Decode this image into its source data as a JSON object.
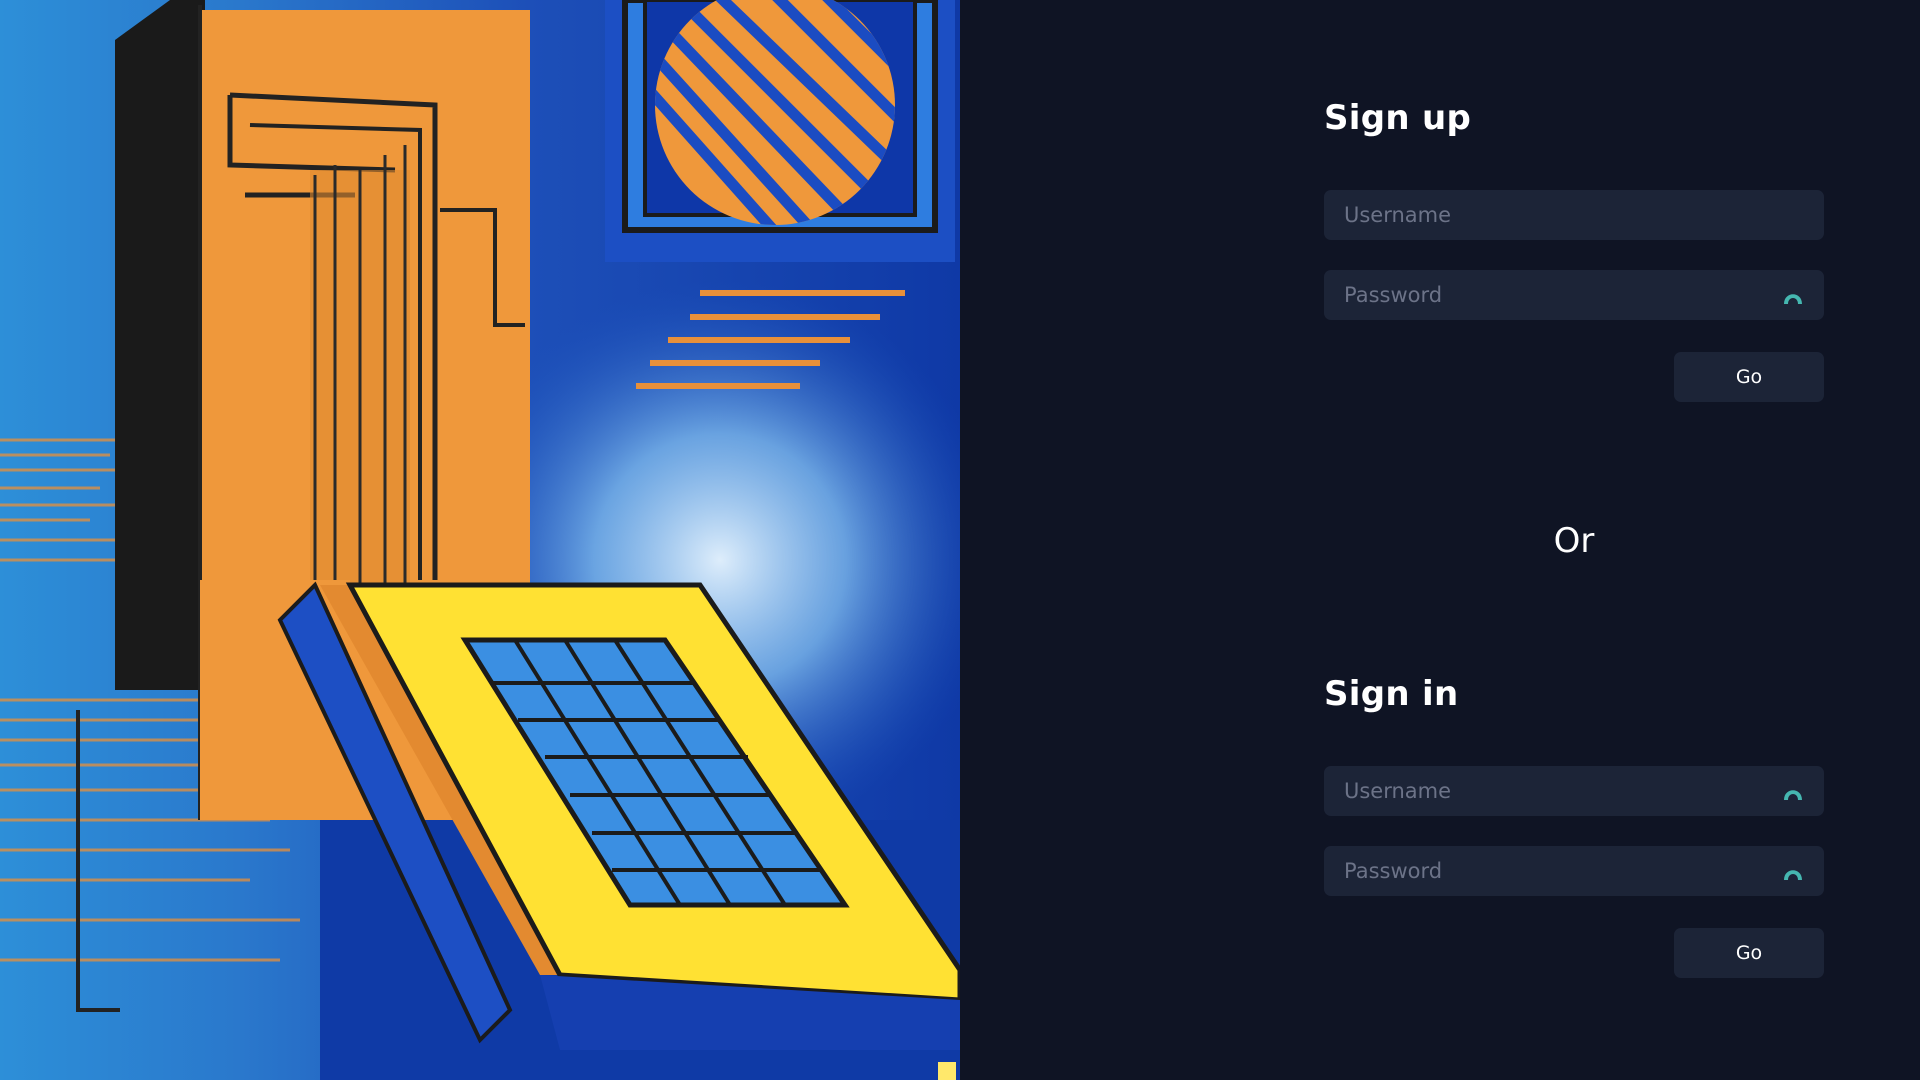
{
  "signup": {
    "title": "Sign up",
    "username_placeholder": "Username",
    "password_placeholder": "Password",
    "go_label": "Go"
  },
  "divider": {
    "label": "Or"
  },
  "signin": {
    "title": "Sign in",
    "username_placeholder": "Username",
    "password_placeholder": "Password",
    "go_label": "Go"
  },
  "icons": {
    "field_icon": "eye-icon",
    "field_icon_color": "#45b7b0"
  }
}
